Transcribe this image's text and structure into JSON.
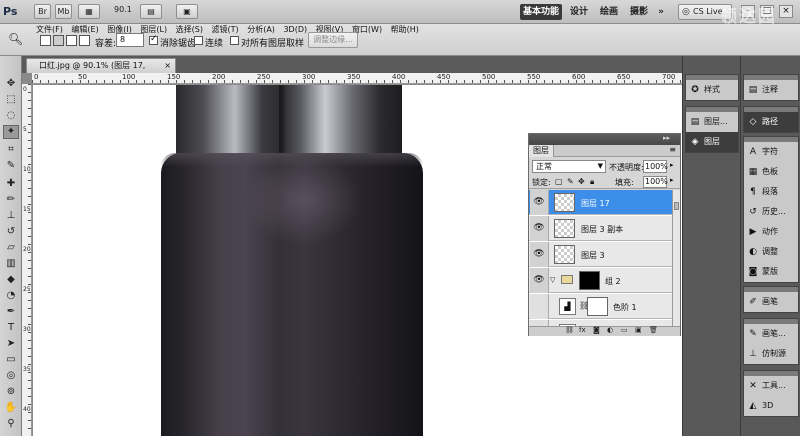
{
  "app": {
    "logo": "Ps",
    "zoom": "90.1",
    "buttons": {
      "br": "Br",
      "mb": "Mb"
    },
    "workspaces": [
      "基本功能",
      "设计",
      "绘画",
      "摄影"
    ],
    "active_workspace": "基本功能",
    "more_workspaces": "»",
    "cs_live": "CS Live",
    "win_min": "–",
    "win_max": "□",
    "win_close": "×",
    "watermark": "领达园"
  },
  "menu": [
    "文件(F)",
    "编辑(E)",
    "图像(I)",
    "图层(L)",
    "选择(S)",
    "滤镜(T)",
    "分析(A)",
    "3D(D)",
    "视图(V)",
    "窗口(W)",
    "帮助(H)"
  ],
  "options": {
    "tolerance_label": "容差:",
    "tolerance_value": "8",
    "antialias_label": "消除锯齿",
    "contiguous_label": "连续",
    "sample_all_label": "对所有图层取样",
    "refine_edge": "调整边缘..."
  },
  "document": {
    "tab_title": "口红.jpg @ 90.1% (图层 17, RGB/8) *",
    "close": "×",
    "ruler_h": [
      "0",
      "50",
      "100",
      "150",
      "200",
      "250",
      "300",
      "350",
      "400",
      "450",
      "500",
      "550",
      "600",
      "650",
      "700"
    ],
    "ruler_v": [
      "0",
      "5",
      "10",
      "15",
      "20",
      "25",
      "30",
      "35",
      "40"
    ]
  },
  "layers_panel": {
    "tab": "图层",
    "collapse": "▸▸",
    "menu": "≡",
    "blend_mode": "正常",
    "opacity_label": "不透明度:",
    "opacity": "100%",
    "lock_label": "锁定:",
    "fill_label": "填充:",
    "fill": "100%",
    "layers": [
      {
        "name": "图层 17",
        "selected": true
      },
      {
        "name": "图层 3 副本",
        "selected": false
      },
      {
        "name": "图层 3",
        "selected": false
      },
      {
        "name": "组 2",
        "selected": false
      },
      {
        "name": "色阶 1",
        "selected": false
      }
    ]
  },
  "dock": {
    "col1": [
      "样式",
      "图层...",
      "图层"
    ],
    "col2a": [
      "注释"
    ],
    "col2b": [
      "路径"
    ],
    "col2c": [
      "字符",
      "色板",
      "段落",
      "历史...",
      "动作",
      "调整",
      "蒙版"
    ],
    "col2d": [
      "画笔"
    ],
    "col2e": [
      "画笔...",
      "仿制源"
    ],
    "col2f": [
      "工具...",
      "3D"
    ]
  }
}
